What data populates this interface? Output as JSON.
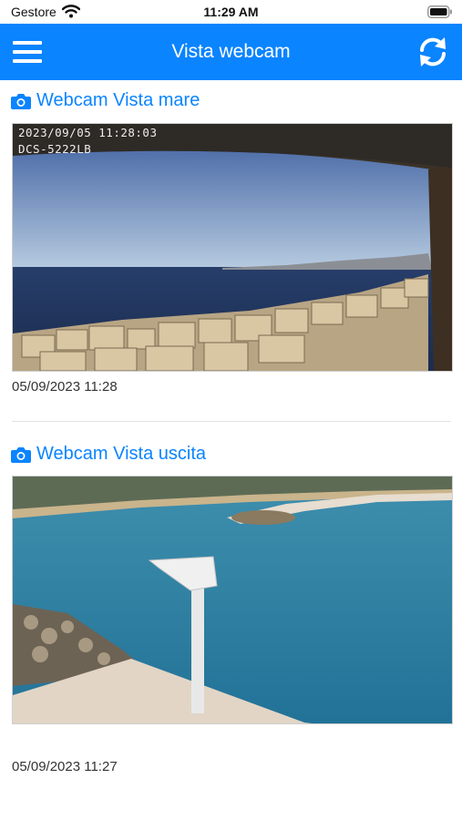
{
  "status_bar": {
    "carrier": "Gestore",
    "time": "11:29 AM"
  },
  "navbar": {
    "title": "Vista webcam",
    "menu_icon": "hamburger-menu-icon",
    "refresh_icon": "refresh-icon"
  },
  "colors": {
    "accent": "#0a84ff",
    "nav_text": "#ffffff"
  },
  "webcams": [
    {
      "title": "Webcam Vista mare",
      "icon": "camera-icon",
      "overlay_date": "2023/09/05 11:28:03",
      "overlay_model": "DCS-5222LB",
      "timestamp": "05/09/2023 11:28"
    },
    {
      "title": "Webcam Vista uscita",
      "icon": "camera-icon",
      "timestamp": "05/09/2023 11:27"
    }
  ]
}
